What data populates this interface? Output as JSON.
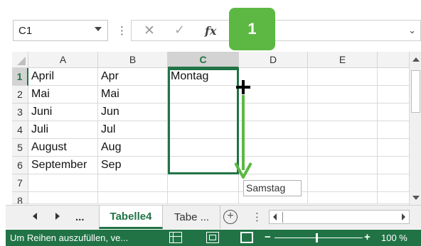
{
  "formula_bar": {
    "name_box": "C1",
    "more_label": "⋮",
    "cancel_glyph": "✕",
    "enter_glyph": "✓",
    "function_label": "fx",
    "formula_value": "",
    "expand_glyph": "⌄"
  },
  "step_badge": "1",
  "columns": [
    "A",
    "B",
    "C",
    "D",
    "E"
  ],
  "selected_column": "C",
  "rows": [
    {
      "num": "1",
      "a": "April",
      "b": "Apr",
      "c": "Montag"
    },
    {
      "num": "2",
      "a": "Mai",
      "b": "Mai",
      "c": ""
    },
    {
      "num": "3",
      "a": "Juni",
      "b": "Jun",
      "c": ""
    },
    {
      "num": "4",
      "a": "Juli",
      "b": "Jul",
      "c": ""
    },
    {
      "num": "5",
      "a": "August",
      "b": "Aug",
      "c": ""
    },
    {
      "num": "6",
      "a": "September",
      "b": "Sep",
      "c": ""
    },
    {
      "num": "7",
      "a": "",
      "b": "",
      "c": ""
    },
    {
      "num": "8",
      "a": "",
      "b": "",
      "c": ""
    }
  ],
  "autofill_tooltip": "Samstag",
  "sheet_tabs": {
    "more_label": "...",
    "active": "Tabelle4",
    "other": "Tabe ...",
    "add_label": "+",
    "options_label": "⋮"
  },
  "status_bar": {
    "message": "Um Reihen auszufüllen, ve...",
    "zoom_minus": "−",
    "zoom_plus": "+",
    "zoom": "100 %"
  },
  "colors": {
    "excel_green": "#217346",
    "badge_green": "#5cb843"
  }
}
